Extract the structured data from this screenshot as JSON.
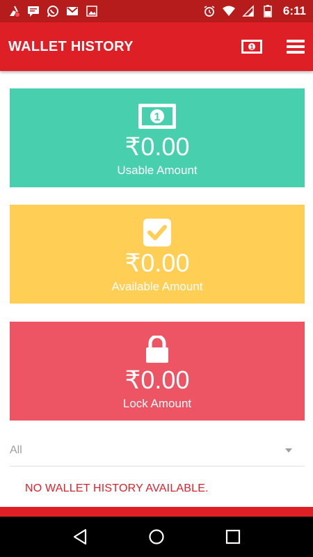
{
  "status_bar": {
    "time": "6:11",
    "icons_left": [
      "cleaner-icon",
      "message-icon",
      "whatsapp-icon",
      "gmail-icon",
      "image-icon"
    ],
    "icons_right": [
      "alarm-icon",
      "wifi-icon",
      "signal-icon",
      "battery-icon"
    ]
  },
  "app_bar": {
    "title": "WALLET HISTORY",
    "actions": [
      "money-icon",
      "menu-icon"
    ]
  },
  "cards": {
    "usable": {
      "amount": "₹0.00",
      "label": "Usable Amount",
      "icon": "money-icon",
      "color": "#48cfad"
    },
    "available": {
      "amount": "₹0.00",
      "label": "Available Amount",
      "icon": "checkbox-icon",
      "color": "#ffce54"
    },
    "lock": {
      "amount": "₹0.00",
      "label": "Lock Amount",
      "icon": "lock-icon",
      "color": "#ed5565"
    }
  },
  "filter": {
    "selected": "All"
  },
  "empty_message": "NO WALLET HISTORY AVAILABLE.",
  "colors": {
    "primary": "#df1f26",
    "status_bar": "#b71c1c"
  },
  "nav_bar": [
    "back-icon",
    "home-icon",
    "recents-icon"
  ]
}
